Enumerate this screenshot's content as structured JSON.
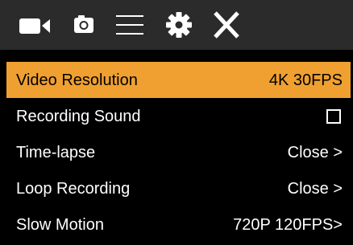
{
  "tabs": [
    {
      "icon": "video-camera-icon",
      "selected": true
    },
    {
      "icon": "photo-camera-icon",
      "selected": false
    },
    {
      "icon": "menu-list-icon",
      "selected": false
    },
    {
      "icon": "gear-icon",
      "selected": false
    },
    {
      "icon": "close-icon",
      "selected": false
    }
  ],
  "colors": {
    "tabbar_bg": "#2b2b2b",
    "background": "#000000",
    "selected_row": "#f0a030",
    "text": "#ffffff"
  },
  "menu": {
    "items": [
      {
        "label": "Video Resolution",
        "value": "4K 30FPS",
        "selected": true
      },
      {
        "label": "Recording Sound",
        "checkbox": true,
        "checked": false
      },
      {
        "label": "Time-lapse",
        "value": "Close >"
      },
      {
        "label": "Loop Recording",
        "value": "Close >"
      },
      {
        "label": "Slow Motion",
        "value": "720P 120FPS>"
      }
    ]
  }
}
